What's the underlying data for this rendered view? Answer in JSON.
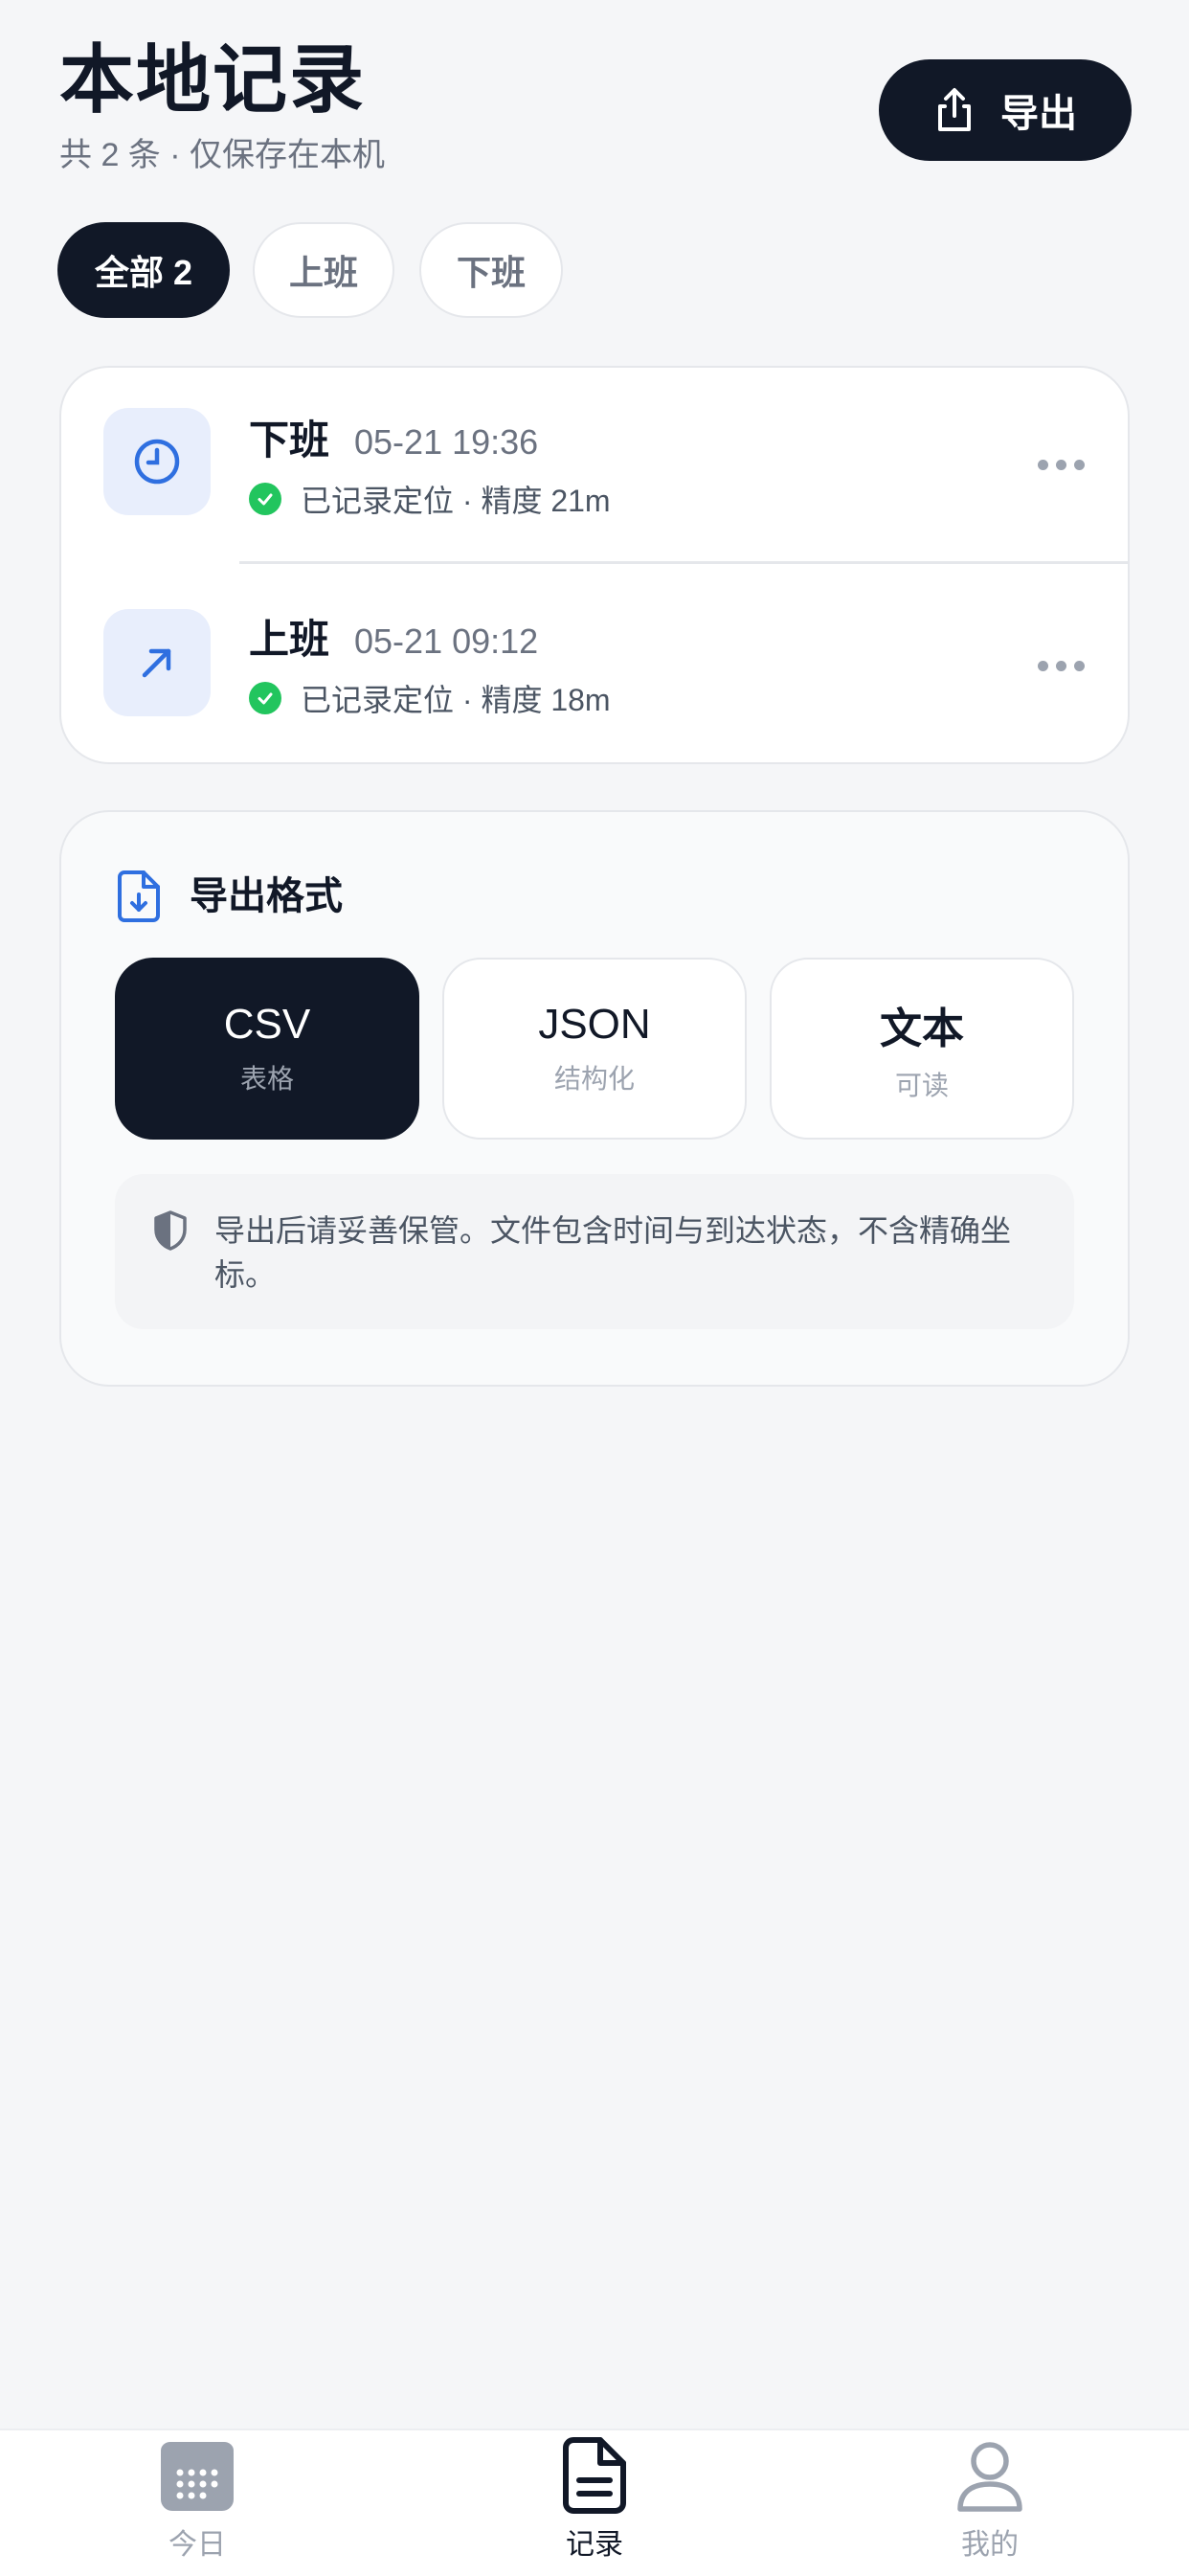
{
  "header": {
    "title": "本地记录",
    "subtitle": "共 2 条 · 仅保存在本机",
    "export_label": "导出"
  },
  "filters": [
    {
      "label": "全部 2",
      "active": true
    },
    {
      "label": "上班",
      "active": false
    },
    {
      "label": "下班",
      "active": false
    }
  ],
  "records": [
    {
      "type": "下班",
      "time": "05-21 19:36",
      "status": "已记录定位 · 精度 21m",
      "icon": "clock-icon"
    },
    {
      "type": "上班",
      "time": "05-21 09:12",
      "status": "已记录定位 · 精度 18m",
      "icon": "arrow-up-right-icon"
    }
  ],
  "export_format": {
    "title": "导出格式",
    "options": [
      {
        "name": "CSV",
        "desc": "表格",
        "selected": true
      },
      {
        "name": "JSON",
        "desc": "结构化",
        "selected": false
      },
      {
        "name": "文本",
        "desc": "可读",
        "selected": false
      }
    ],
    "note": "导出后请妥善保管。文件包含时间与到达状态，不含精确坐标。"
  },
  "tabbar": [
    {
      "label": "今日",
      "icon": "calendar-icon",
      "active": false
    },
    {
      "label": "记录",
      "icon": "document-icon",
      "active": true
    },
    {
      "label": "我的",
      "icon": "user-icon",
      "active": false
    }
  ],
  "colors": {
    "primary": "#111827",
    "accent": "#2f6fe0",
    "success": "#22c55e",
    "muted": "#6b7280",
    "background": "#f5f6f8"
  }
}
